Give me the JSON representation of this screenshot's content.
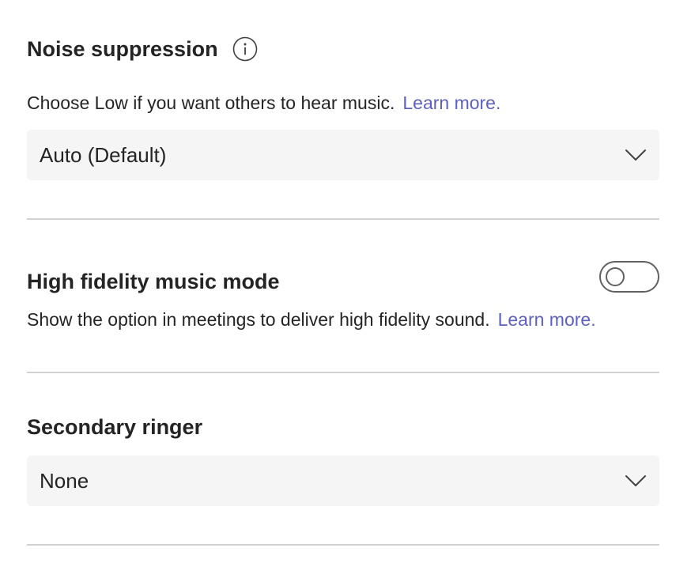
{
  "noise_suppression": {
    "title": "Noise suppression",
    "info_icon": "info-icon",
    "description": "Choose Low if you want others to hear music.",
    "learn_more": "Learn more.",
    "selected_value": "Auto (Default)"
  },
  "high_fidelity": {
    "title": "High fidelity music mode",
    "description": "Show the option in meetings to deliver high fidelity sound.",
    "learn_more": "Learn more.",
    "toggle_on": false
  },
  "secondary_ringer": {
    "title": "Secondary ringer",
    "selected_value": "None"
  },
  "colors": {
    "link": "#5b5fc7",
    "text": "#242424",
    "dropdown_bg": "#f5f5f5",
    "divider": "#d1d1d1"
  }
}
